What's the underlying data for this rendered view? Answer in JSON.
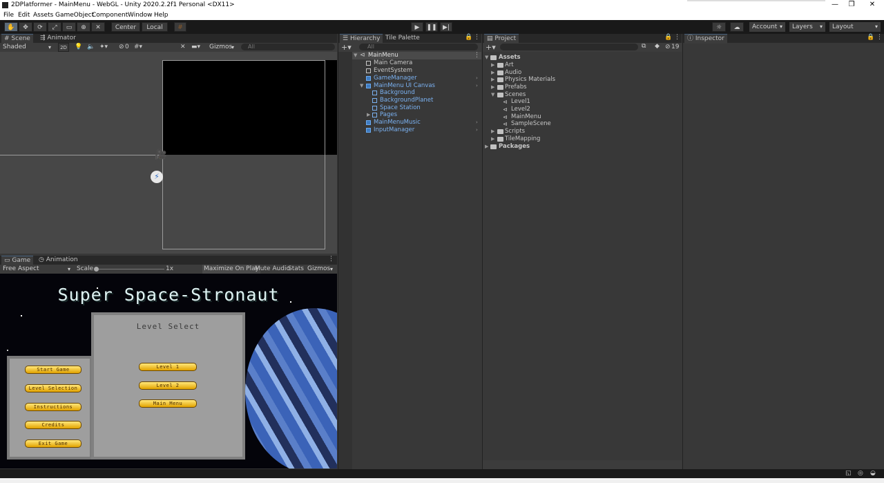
{
  "window": {
    "title": "2DPlatformer - MainMenu - WebGL - Unity 2020.2.2f1 Personal <DX11>"
  },
  "menu": [
    "File",
    "Edit",
    "Assets",
    "GameObject",
    "Component",
    "Window",
    "Help"
  ],
  "toolbar": {
    "center": "Center",
    "local": "Local",
    "account": "Account",
    "layers": "Layers",
    "layout": "Layout"
  },
  "scene": {
    "tab": "Scene",
    "tab2": "Animator",
    "shading": "Shaded",
    "mode_2d": "2D",
    "gizmos": "Gizmos",
    "search_placeholder": "All",
    "hidden_count": "0"
  },
  "game": {
    "tab": "Game",
    "tab2": "Animation",
    "aspect": "Free Aspect",
    "scale_label": "Scale",
    "scale_value": "1x",
    "maximize": "Maximize On Play",
    "mute": "Mute Audio",
    "stats": "Stats",
    "gizmos": "Gizmos",
    "title": "Super Space-Stronaut",
    "panel_title": "Level Select",
    "left_buttons": [
      "Start Game",
      "Level Selection",
      "Instructions",
      "Credits",
      "Exit Game"
    ],
    "level_buttons": [
      "Level 1",
      "Level 2",
      "Main Menu"
    ]
  },
  "hierarchy": {
    "tab": "Hierarchy",
    "tab2": "Tile Palette",
    "search_placeholder": "All",
    "root": "MainMenu",
    "items": [
      "Main Camera",
      "EventSystem",
      "GameManager",
      "MainMenu UI Canvas",
      "Background",
      "BackgroundPlanet",
      "Space Station",
      "Pages",
      "MainMenuMusic",
      "InputManager"
    ]
  },
  "project": {
    "tab": "Project",
    "hidden_count": "19",
    "assets": "Assets",
    "folders": [
      "Art",
      "Audio",
      "Physics Materials",
      "Prefabs",
      "Scenes"
    ],
    "scenes": [
      "Level1",
      "Level2",
      "MainMenu",
      "SampleScene"
    ],
    "folders2": [
      "Scripts",
      "TileMapping"
    ],
    "packages": "Packages"
  },
  "inspector": {
    "tab": "Inspector"
  },
  "colors": {
    "accent": "#46607c",
    "link_blue": "#7bb2f2",
    "gold": "#e2a300"
  }
}
